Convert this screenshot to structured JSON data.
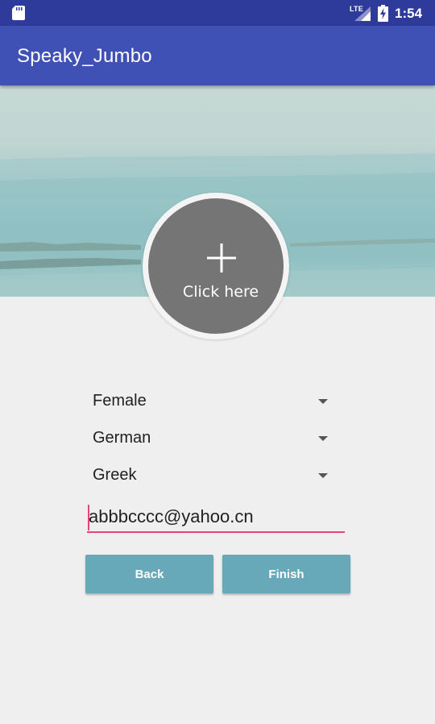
{
  "status_bar": {
    "network_label": "LTE",
    "time": "1:54",
    "icons": [
      "sd-card-icon",
      "signal-icon",
      "battery-charging-icon"
    ]
  },
  "app_bar": {
    "title": "Speaky_Jumbo",
    "color": "#3f51b5"
  },
  "avatar": {
    "icon": "plus-icon",
    "label": "Click here"
  },
  "form": {
    "gender": {
      "value": "Female"
    },
    "language1": {
      "value": "German"
    },
    "language2": {
      "value": "Greek"
    },
    "email": {
      "value": "abbbcccc@yahoo.cn"
    }
  },
  "buttons": {
    "back_label": "Back",
    "finish_label": "Finish",
    "color": "#67a9b8"
  },
  "colors": {
    "status_bar": "#2f3b9a",
    "accent": "#e2457a",
    "background": "#efefef"
  }
}
